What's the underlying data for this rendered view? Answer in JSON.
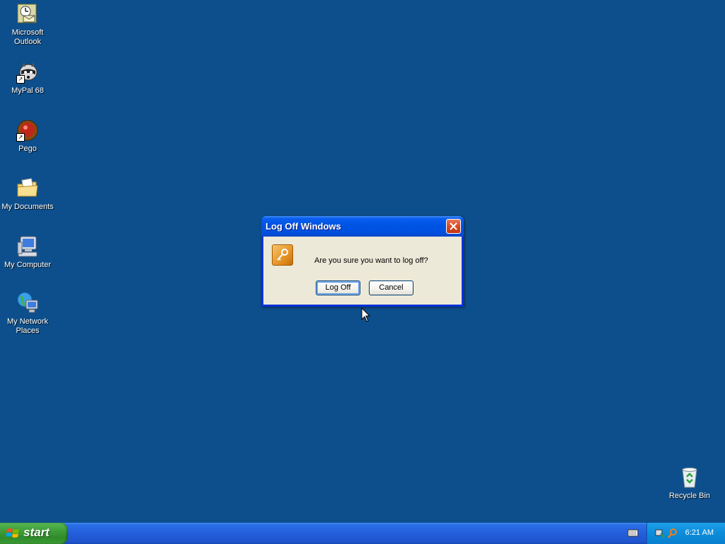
{
  "desktop": {
    "background_color": "#0d4f8c",
    "icons": [
      {
        "label": "Microsoft Outlook",
        "icon": "outlook-icon"
      },
      {
        "label": "MyPal 68",
        "icon": "mypal-raccoon-icon"
      },
      {
        "label": "Pego",
        "icon": "pego-icon"
      },
      {
        "label": "My Documents",
        "icon": "my-documents-icon"
      },
      {
        "label": "My Computer",
        "icon": "my-computer-icon"
      },
      {
        "label": "My Network Places",
        "icon": "network-places-icon"
      },
      {
        "label": "Recycle Bin",
        "icon": "recycle-bin-icon"
      }
    ]
  },
  "dialog": {
    "title": "Log Off Windows",
    "message": "Are you sure you want to log off?",
    "logoff_label": "Log Off",
    "cancel_label": "Cancel",
    "icon": "key-icon"
  },
  "taskbar": {
    "start_label": "start",
    "clock": "6:21 AM",
    "tray_icons": [
      "keyboard-icon",
      "network-tray-icon",
      "search-tray-icon"
    ]
  }
}
